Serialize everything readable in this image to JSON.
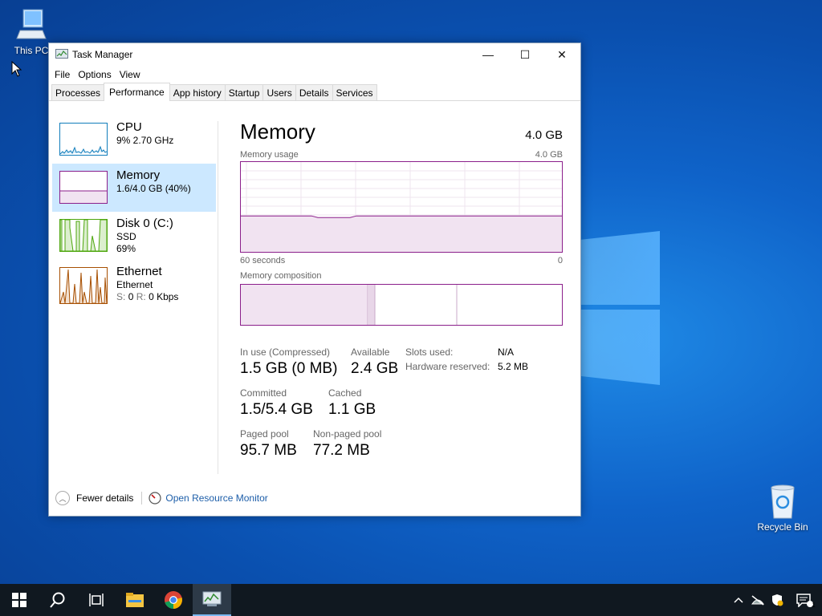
{
  "desktop": {
    "this_pc_label": "This PC",
    "recycle_bin_label": "Recycle Bin"
  },
  "window": {
    "title": "Task Manager",
    "caption": {
      "minimize": "—",
      "maximize": "☐",
      "close": "✕"
    }
  },
  "menu": [
    "File",
    "Options",
    "View"
  ],
  "tabs": [
    "Processes",
    "Performance",
    "App history",
    "Startup",
    "Users",
    "Details",
    "Services"
  ],
  "active_tab": "Performance",
  "sidebar": {
    "cpu": {
      "name": "CPU",
      "detail": "9%  2.70 GHz",
      "color": "#117dbb"
    },
    "memory": {
      "name": "Memory",
      "detail": "1.6/4.0 GB (40%)",
      "color": "#8b1f8b"
    },
    "disk": {
      "name": "Disk 0 (C:)",
      "type": "SSD",
      "percent": "69%",
      "color": "#4da60c"
    },
    "ethernet": {
      "name": "Ethernet",
      "sub": "Ethernet",
      "send_label": "S:",
      "send_value": "0",
      "recv_label": "R:",
      "recv_value": "0 Kbps",
      "color": "#a74f01"
    }
  },
  "memory": {
    "heading": "Memory",
    "total": "4.0 GB",
    "usage_label": "Memory usage",
    "usage_max": "4.0 GB",
    "time_left": "60 seconds",
    "time_right": "0",
    "usage_fraction": 0.4,
    "composition_label": "Memory composition",
    "in_use_label": "In use (Compressed)",
    "in_use_value": "1.5 GB (0 MB)",
    "available_label": "Available",
    "available_value": "2.4 GB",
    "committed_label": "Committed",
    "committed_value": "1.5/5.4 GB",
    "cached_label": "Cached",
    "cached_value": "1.1 GB",
    "paged_label": "Paged pool",
    "paged_value": "95.7 MB",
    "nonpaged_label": "Non-paged pool",
    "nonpaged_value": "77.2 MB",
    "slots_label": "Slots used:",
    "slots_value": "N/A",
    "hw_reserved_label": "Hardware reserved:",
    "hw_reserved_value": "5.2 MB"
  },
  "footer": {
    "fewer_details": "Fewer details",
    "open_resource_monitor": "Open Resource Monitor"
  },
  "taskbar": {
    "items": [
      "start-icon",
      "search-icon",
      "task-view-icon",
      "file-explorer-icon",
      "chrome-icon",
      "task-manager-icon"
    ],
    "notification_count": "1"
  }
}
